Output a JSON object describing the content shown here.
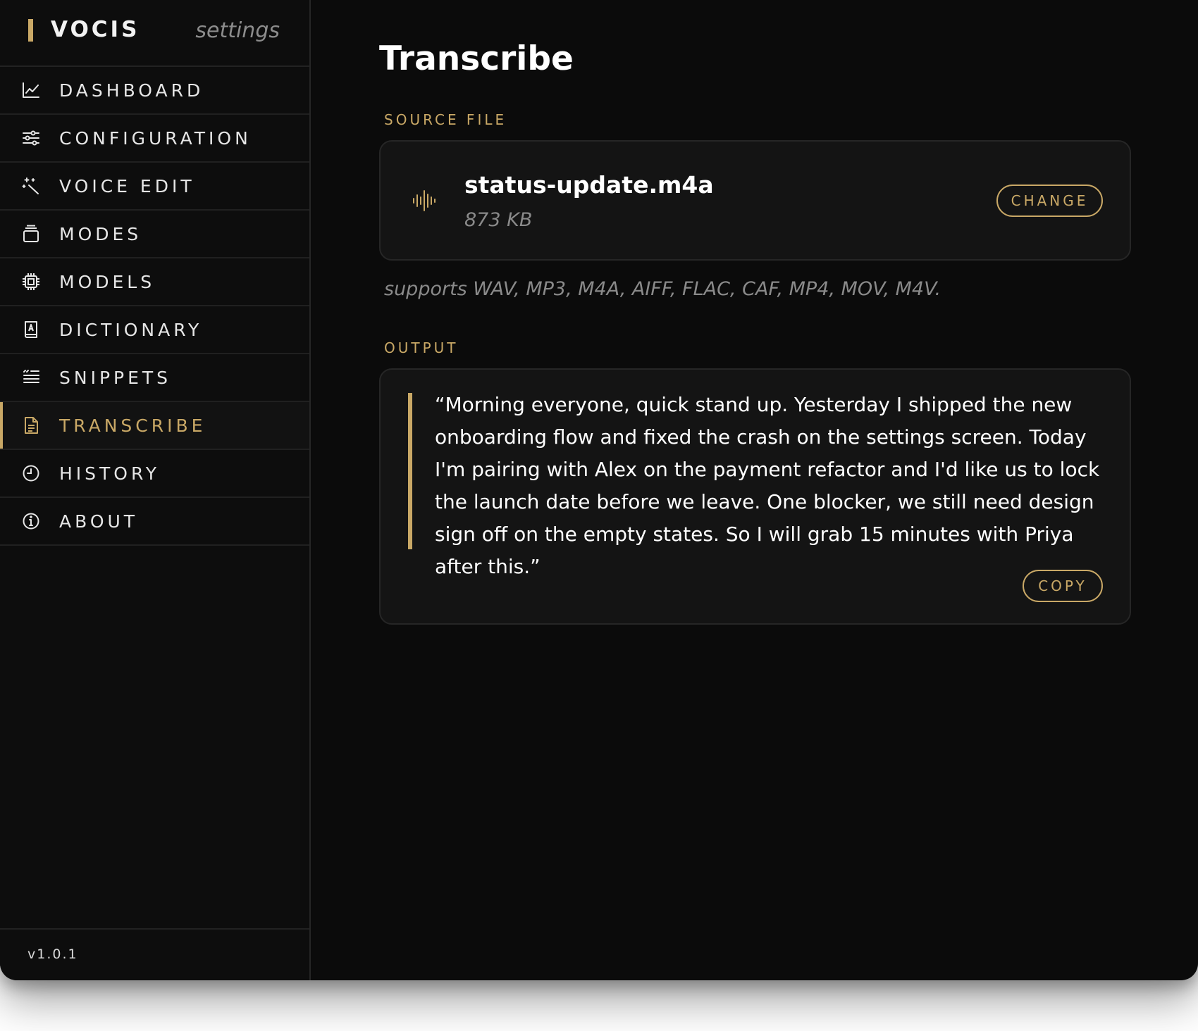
{
  "app": {
    "name": "VOCIS",
    "subtitle": "settings",
    "version": "v1.0.1",
    "accent_color": "#c9a866"
  },
  "sidebar": {
    "items": [
      {
        "label": "DASHBOARD",
        "icon": "chart-line-icon",
        "active": false
      },
      {
        "label": "CONFIGURATION",
        "icon": "sliders-icon",
        "active": false
      },
      {
        "label": "VOICE EDIT",
        "icon": "magic-wand-icon",
        "active": false
      },
      {
        "label": "MODES",
        "icon": "stack-icon",
        "active": false
      },
      {
        "label": "MODELS",
        "icon": "chip-icon",
        "active": false
      },
      {
        "label": "DICTIONARY",
        "icon": "book-icon",
        "active": false
      },
      {
        "label": "SNIPPETS",
        "icon": "snippets-icon",
        "active": false
      },
      {
        "label": "TRANSCRIBE",
        "icon": "document-icon",
        "active": true
      },
      {
        "label": "HISTORY",
        "icon": "clock-icon",
        "active": false
      },
      {
        "label": "ABOUT",
        "icon": "info-icon",
        "active": false
      }
    ]
  },
  "main": {
    "title": "Transcribe",
    "source": {
      "section_label": "SOURCE FILE",
      "file_name": "status-update.m4a",
      "file_size": "873 KB",
      "change_label": "CHANGE",
      "icon": "audio-waveform-icon",
      "supports_text": "supports WAV, MP3, M4A, AIFF, FLAC, CAF, MP4, MOV, M4V."
    },
    "output": {
      "section_label": "OUTPUT",
      "transcript": "“Morning everyone, quick stand up. Yesterday I shipped the new onboarding flow and fixed the crash on the settings screen. Today I'm pairing with Alex on the payment refactor and I'd like us to lock the launch date before we leave. One blocker, we still need design sign off on the empty states. So I will grab 15 minutes with Priya after this.”",
      "copy_label": "COPY"
    }
  }
}
